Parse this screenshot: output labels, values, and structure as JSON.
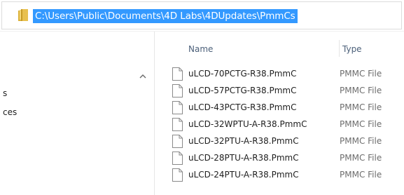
{
  "address_bar": {
    "path": "C:\\Users\\Public\\Documents\\4D Labs\\4DUpdates\\PmmCs",
    "icon": "folder-icon"
  },
  "nav_pane": {
    "items": [
      "s",
      "ces"
    ],
    "scroll_up_icon": "chevron-up-icon"
  },
  "file_list": {
    "columns": {
      "name": "Name",
      "type": "Type"
    },
    "rows": [
      {
        "name": "uLCD-70PCTG-R38.PmmC",
        "type": "PMMC File"
      },
      {
        "name": "uLCD-57PCTG-R38.PmmC",
        "type": "PMMC File"
      },
      {
        "name": "uLCD-43PCTG-R38.PmmC",
        "type": "PMMC File"
      },
      {
        "name": "uLCD-32WPTU-A-R38.PmmC",
        "type": "PMMC File"
      },
      {
        "name": "uLCD-32PTU-A-R38.PmmC",
        "type": "PMMC File"
      },
      {
        "name": "uLCD-28PTU-A-R38.PmmC",
        "type": "PMMC File"
      },
      {
        "name": "uLCD-24PTU-A-R38.PmmC",
        "type": "PMMC File"
      }
    ]
  },
  "colors": {
    "selection": "#3399ff",
    "header_text": "#4c607a",
    "type_text": "#6d6d6d"
  }
}
